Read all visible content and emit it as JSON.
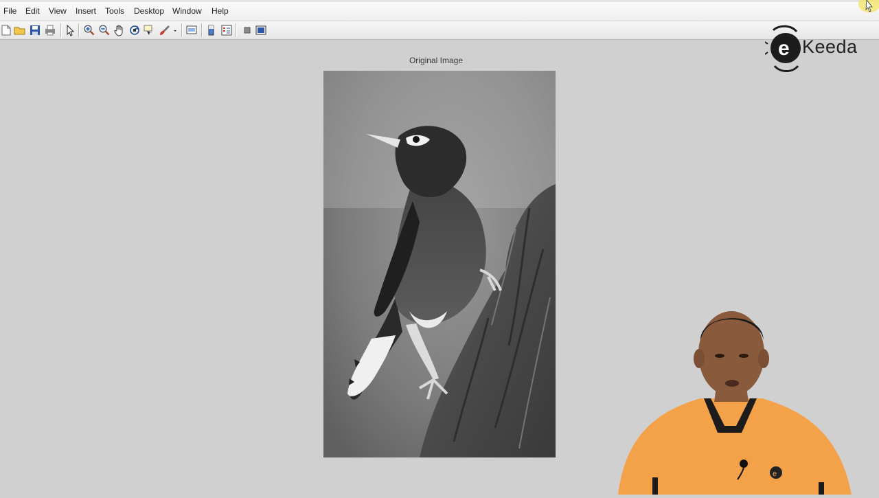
{
  "menubar": {
    "items": [
      "File",
      "Edit",
      "View",
      "Insert",
      "Tools",
      "Desktop",
      "Window",
      "Help"
    ]
  },
  "toolbar": {
    "buttons": [
      "new-figure-icon",
      "open-file-icon",
      "save-icon",
      "print-icon",
      "edit-plot-arrow-icon",
      "zoom-in-icon",
      "zoom-out-icon",
      "pan-hand-icon",
      "rotate-3d-icon",
      "data-cursor-icon",
      "brush-icon",
      "link-plot-icon",
      "insert-colorbar-icon",
      "insert-legend-icon",
      "hide-plot-tools-icon",
      "show-plot-tools-icon"
    ]
  },
  "figure": {
    "axes_title": "Original Image",
    "image_description_icon": "grayscale-bird-image"
  },
  "branding": {
    "logo_text": "Keeda",
    "logo_icon": "ekeeda-logo-icon",
    "shirt_badge": "ekeeda-shirt-logo"
  },
  "colors": {
    "background": "#cfcfcf",
    "toolbar": "#eeeeee",
    "shirt_orange": "#f4a24a",
    "cursor_highlight": "#f5e66b"
  }
}
